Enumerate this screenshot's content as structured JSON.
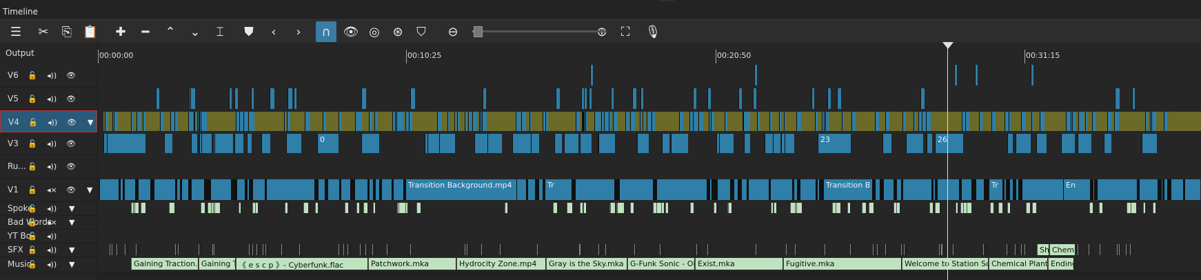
{
  "panel": {
    "title": "Timeline"
  },
  "toolbar": {
    "buttons": [
      {
        "name": "menu-icon",
        "glyph": "☰"
      },
      {
        "name": "cut-icon",
        "glyph": "✂"
      },
      {
        "name": "copy-icon",
        "glyph": "⎘"
      },
      {
        "name": "paste-icon",
        "glyph": "📋"
      },
      {
        "name": "append-icon",
        "glyph": "✚"
      },
      {
        "name": "remove-icon",
        "glyph": "━"
      },
      {
        "name": "lift-icon",
        "glyph": "⌃"
      },
      {
        "name": "overwrite-icon",
        "glyph": "⌄"
      },
      {
        "name": "split-icon",
        "glyph": "⌶"
      },
      {
        "name": "marker-icon",
        "glyph": "⛊"
      },
      {
        "name": "prev-marker-icon",
        "glyph": "‹"
      },
      {
        "name": "next-marker-icon",
        "glyph": "›"
      },
      {
        "name": "snap-icon",
        "glyph": "∩",
        "active": true
      },
      {
        "name": "scrub-icon",
        "glyph": "👁"
      },
      {
        "name": "ripple-icon",
        "glyph": "◎"
      },
      {
        "name": "ripple-all-icon",
        "glyph": "⊛"
      },
      {
        "name": "ripple-markers-icon",
        "glyph": "⛉"
      },
      {
        "name": "zoom-out-icon",
        "glyph": "⊖"
      },
      {
        "name": "zoom-in-icon",
        "glyph": "⊕"
      },
      {
        "name": "zoom-fit-icon",
        "glyph": "⛶"
      },
      {
        "name": "record-audio-icon",
        "glyph": "🎙"
      }
    ],
    "zoom_level": 0.06
  },
  "header": {
    "output_label": "Output"
  },
  "tracks": [
    {
      "name": "V6",
      "kind": "video",
      "hidden_icon": "eye",
      "locked": false,
      "mute_icon": "audio"
    },
    {
      "name": "V5",
      "kind": "video"
    },
    {
      "name": "V4",
      "kind": "video",
      "selected": true,
      "filter": true
    },
    {
      "name": "V3",
      "kind": "video"
    },
    {
      "name": "Ru...",
      "kind": "video"
    },
    {
      "name": "V1",
      "kind": "video",
      "muted": true,
      "filter": true
    },
    {
      "name": "Spoke",
      "kind": "audio",
      "filter": true
    },
    {
      "name": "Bad Words",
      "kind": "audio",
      "muted": true,
      "filter": true
    },
    {
      "name": "YT Bo",
      "kind": "audio"
    },
    {
      "name": "SFX",
      "kind": "audio",
      "filter": true
    },
    {
      "name": "Music",
      "kind": "audio",
      "filter": true
    }
  ],
  "ruler": {
    "labels": [
      {
        "text": "00:00:00"
      },
      {
        "text": "00:10:25"
      },
      {
        "text": "00:20:50"
      },
      {
        "text": "00:31:15"
      }
    ]
  },
  "clips": {
    "v3_labels": [
      "0",
      "23",
      "26"
    ],
    "v1_labels": [
      "Transition Background.mp4",
      "Transition B",
      "Tr",
      "Tr",
      "En"
    ],
    "sfx_labels": [
      "Sh",
      "Chemica"
    ],
    "music_labels": [
      "Gaining Traction.mka",
      "Gaining Tra",
      "《 e s c p 》- Cyberfunk.flac",
      "Patchwork.mka",
      "Hydrocity Zone.mp4",
      "Gray is the Sky.mka",
      "G-Funk Sonic - Oil Oce",
      "Exist.mka",
      "Fugitive.mka",
      "Welcome to Station Square.",
      "Chemical Plant Z",
      "Ending C"
    ]
  },
  "colors": {
    "video_clip": "#2f7fa8",
    "audio_clip": "#bfe3bf",
    "selected_track_clip": "#6b6a28",
    "accent": "#3a7ca5"
  }
}
